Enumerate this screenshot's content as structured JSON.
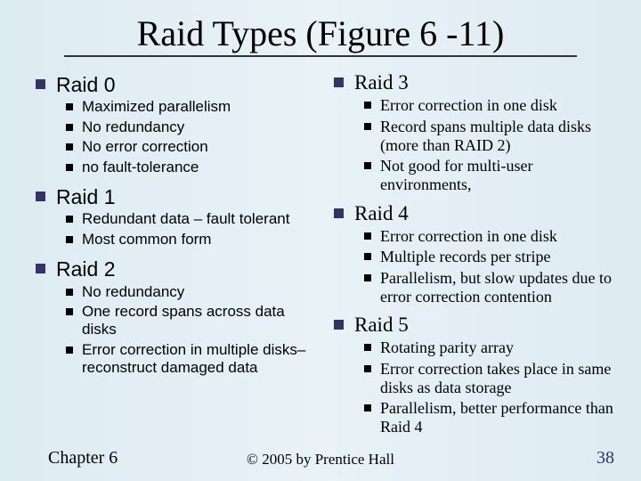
{
  "title": "Raid Types (Figure 6 -11)",
  "left": {
    "sections": [
      {
        "heading": "Raid 0",
        "items": [
          "Maximized parallelism",
          "No redundancy",
          "No error correction",
          "no fault-tolerance"
        ]
      },
      {
        "heading": "Raid 1",
        "items": [
          "Redundant data – fault tolerant",
          "Most common form"
        ]
      },
      {
        "heading": "Raid 2",
        "items": [
          "No redundancy",
          "One record spans across data disks",
          "Error correction in multiple disks– reconstruct damaged data"
        ]
      }
    ]
  },
  "right": {
    "sections": [
      {
        "heading": "Raid 3",
        "items": [
          "Error correction in one disk",
          "Record spans multiple data disks (more than RAID 2)",
          "Not good for multi-user environments,"
        ]
      },
      {
        "heading": "Raid 4",
        "items": [
          "Error correction in one disk",
          "Multiple records per stripe",
          "Parallelism, but slow updates due to error correction contention"
        ]
      },
      {
        "heading": "Raid 5",
        "items": [
          "Rotating parity array",
          "Error correction takes place in same disks as data storage",
          "Parallelism, better performance than Raid 4"
        ]
      }
    ]
  },
  "footer": {
    "left": "Chapter 6",
    "center": "© 2005 by Prentice Hall",
    "right": "38"
  }
}
